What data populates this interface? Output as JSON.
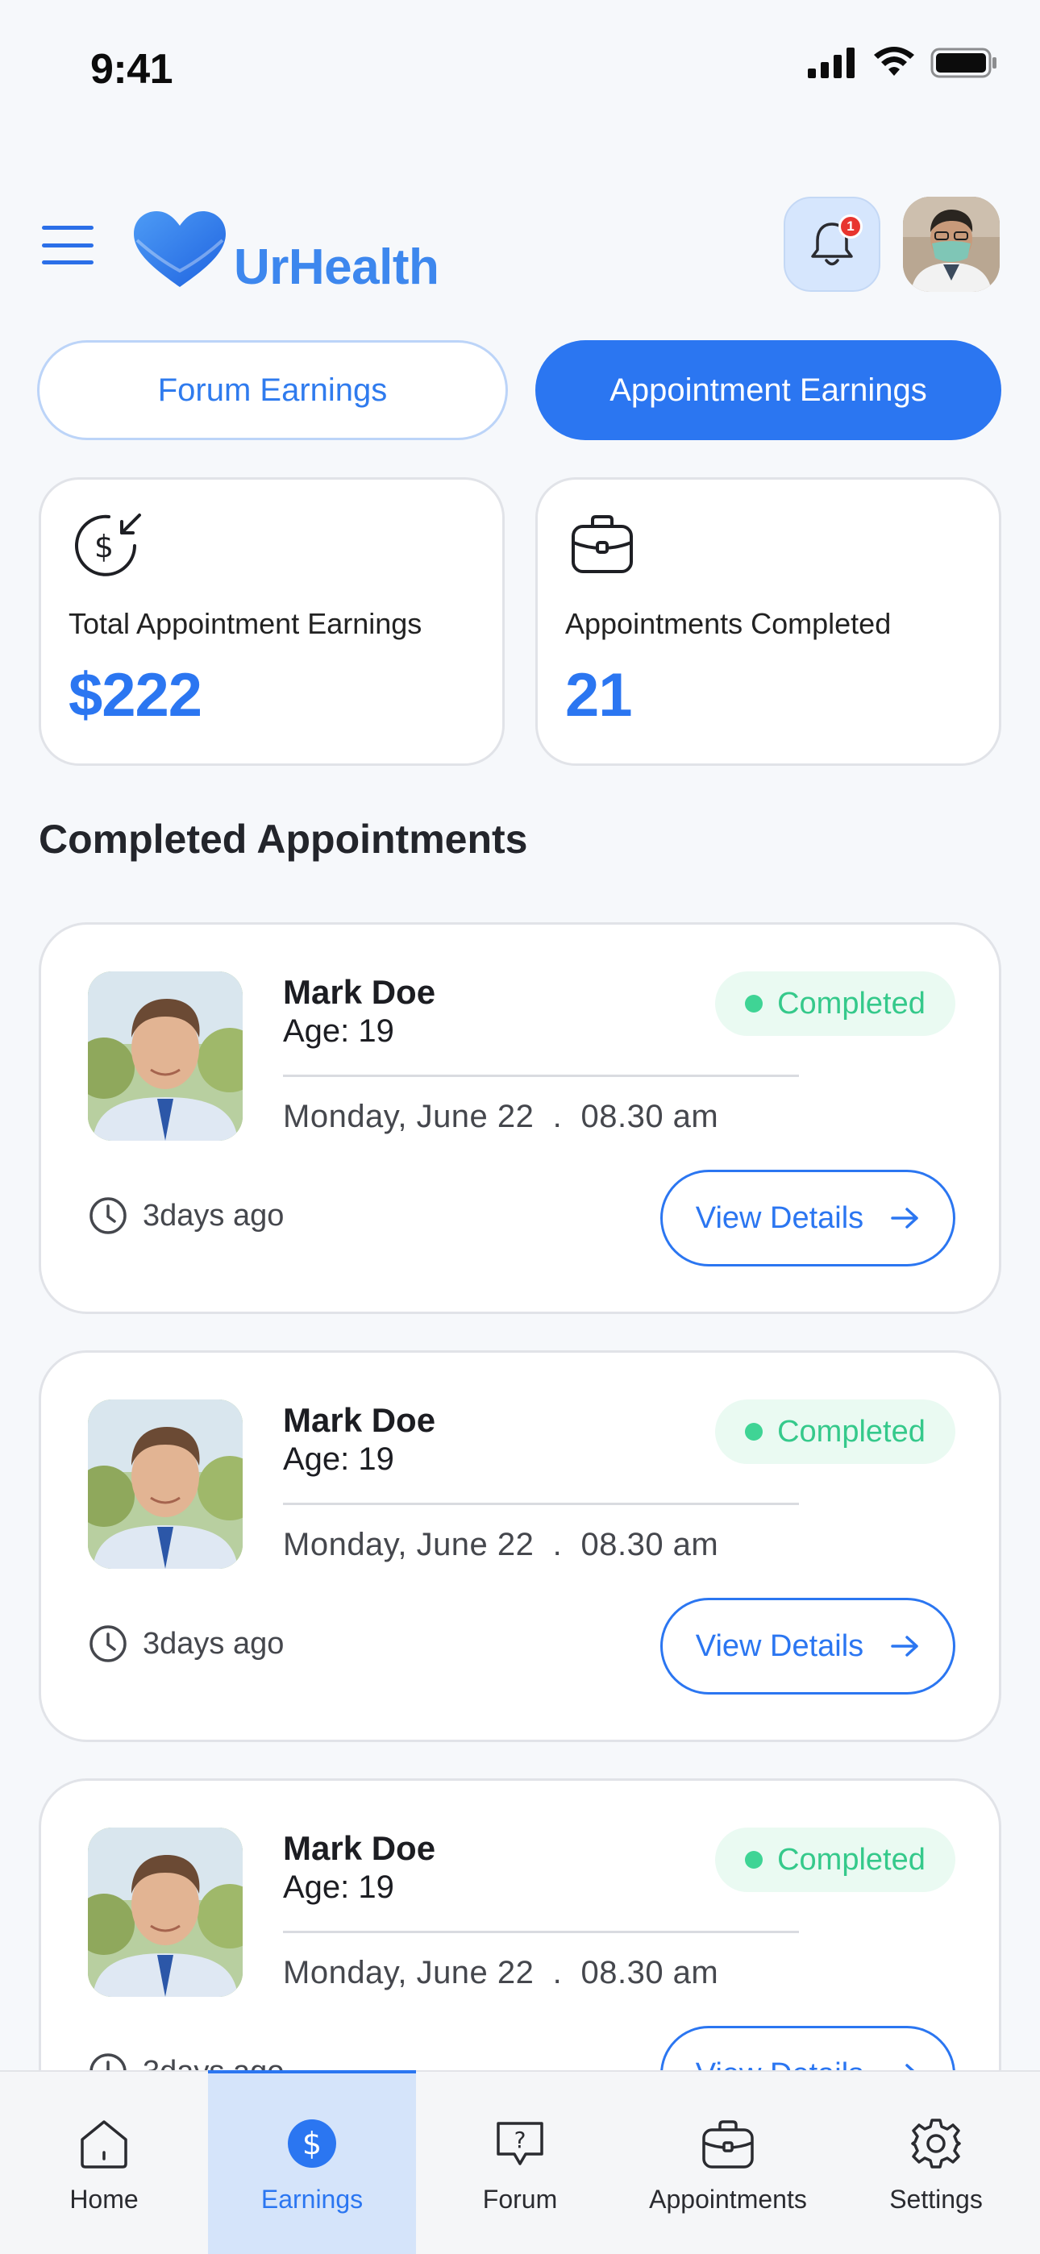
{
  "status_bar": {
    "time": "9:41"
  },
  "header": {
    "brand": "UrHealth",
    "notification_count": "1"
  },
  "tabs": [
    {
      "label": "Forum Earnings",
      "active": false
    },
    {
      "label": "Appointment Earnings",
      "active": true
    }
  ],
  "stats": [
    {
      "label": "Total Appointment Earnings",
      "value": "$222",
      "icon": "dollar-income-icon"
    },
    {
      "label": "Appointments Completed",
      "value": "21",
      "icon": "briefcase-icon"
    }
  ],
  "section_title": "Completed Appointments",
  "appointments": [
    {
      "name": "Mark Doe",
      "age": "Age: 19",
      "status": "Completed",
      "date": "Monday, June 22  .  08.30 am",
      "time_ago": "3days ago",
      "action": "View Details"
    },
    {
      "name": "Mark Doe",
      "age": "Age: 19",
      "status": "Completed",
      "date": "Monday, June 22  .  08.30 am",
      "time_ago": "3days ago",
      "action": "View Details"
    },
    {
      "name": "Mark Doe",
      "age": "Age: 19",
      "status": "Completed",
      "date": "Monday, June 22  .  08.30 am",
      "time_ago": "3days ago",
      "action": "View Details"
    }
  ],
  "bottom_nav": [
    {
      "label": "Home",
      "icon": "home-icon",
      "active": false
    },
    {
      "label": "Earnings",
      "icon": "dollar-icon",
      "active": true
    },
    {
      "label": "Forum",
      "icon": "question-chat-icon",
      "active": false
    },
    {
      "label": "Appointments",
      "icon": "briefcase-icon",
      "active": false
    },
    {
      "label": "Settings",
      "icon": "gear-icon",
      "active": false
    }
  ],
  "colors": {
    "primary": "#2b76f1",
    "brand": "#3d87ee",
    "success": "#35c98b",
    "badge": "#e8352f"
  }
}
